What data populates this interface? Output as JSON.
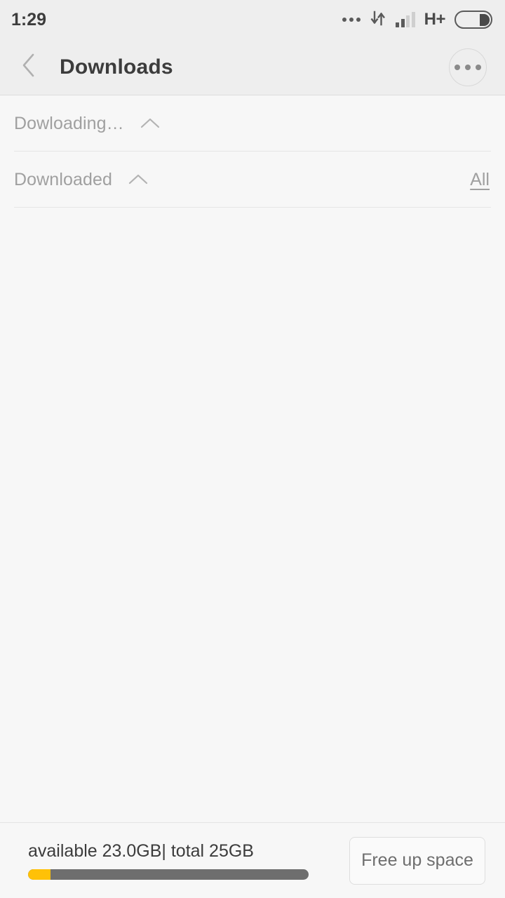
{
  "status_bar": {
    "time": "1:29",
    "ellipsis_icon": "ellipsis-icon",
    "data_transfer_icon": "data-transfer-arrows-icon",
    "signal_icon": "signal-bars-icon",
    "signal_bars_active": 2,
    "signal_bars_total": 4,
    "network_type": "H+",
    "battery_icon": "battery-icon",
    "battery_level_percent": 28
  },
  "title_bar": {
    "back_icon": "chevron-left-icon",
    "title": "Downloads",
    "overflow_icon": "overflow-menu-icon"
  },
  "sections": [
    {
      "label": "Dowloading…",
      "chevron_icon": "chevron-up-icon",
      "expanded": true,
      "action_label": null
    },
    {
      "label": "Downloaded",
      "chevron_icon": "chevron-up-icon",
      "expanded": true,
      "action_label": "All"
    }
  ],
  "bottom_bar": {
    "storage_text": "available 23.0GB| total 25GB",
    "available": "23.0GB",
    "total": "25GB",
    "used_percent": 8,
    "used_color": "#ffc107",
    "track_color": "#6e6e6e",
    "free_button_label": "Free up space"
  }
}
